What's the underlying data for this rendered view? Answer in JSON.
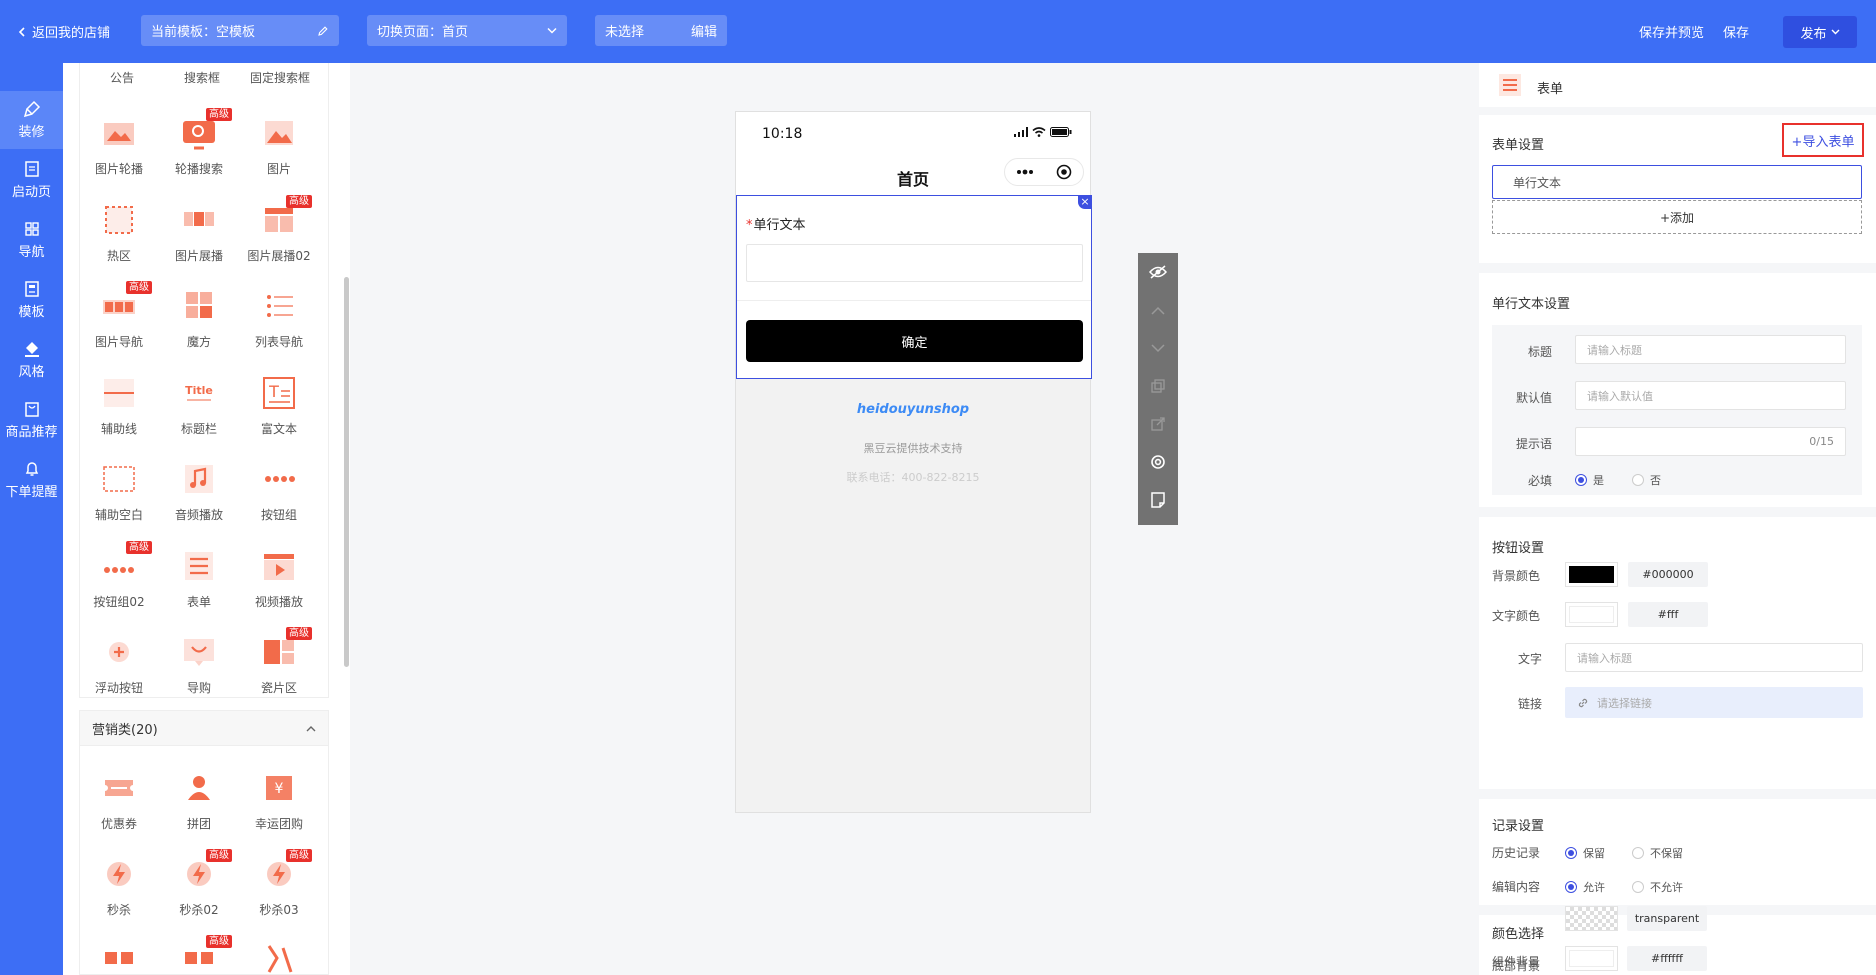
{
  "topbar": {
    "back_label": "返回我的店铺",
    "template_label": "当前模板：空模板",
    "switch_label": "切换页面：首页",
    "selected_label": "未选择",
    "edit_label": "编辑",
    "save_preview_label": "保存并预览",
    "save_label": "保存",
    "publish_label": "发布"
  },
  "rail": [
    {
      "label": "装修",
      "icon": "brush-icon",
      "active": true
    },
    {
      "label": "启动页",
      "icon": "page-icon"
    },
    {
      "label": "导航",
      "icon": "grid-icon"
    },
    {
      "label": "模板",
      "icon": "template-icon"
    },
    {
      "label": "风格",
      "icon": "paint-bucket-icon"
    },
    {
      "label": "商品推荐",
      "icon": "goods-icon"
    },
    {
      "label": "下单提醒",
      "icon": "bell-icon"
    }
  ],
  "components": {
    "top_row": [
      "公告",
      "搜索框",
      "固定搜索框"
    ],
    "basic": [
      {
        "label": "图片轮播",
        "icon": "image-carousel-icon"
      },
      {
        "label": "轮播搜索",
        "icon": "carousel-search-icon",
        "tag": "高级"
      },
      {
        "label": "图片",
        "icon": "image-icon"
      },
      {
        "label": "热区",
        "icon": "hotspot-icon"
      },
      {
        "label": "图片展播",
        "icon": "image-show-icon"
      },
      {
        "label": "图片展播02",
        "icon": "image-show2-icon",
        "tag": "高级"
      },
      {
        "label": "图片导航",
        "icon": "image-nav-icon",
        "tag": "高级"
      },
      {
        "label": "魔方",
        "icon": "cube-icon"
      },
      {
        "label": "列表导航",
        "icon": "list-nav-icon"
      },
      {
        "label": "辅助线",
        "icon": "divider-icon"
      },
      {
        "label": "标题栏",
        "icon": "title-icon"
      },
      {
        "label": "富文本",
        "icon": "richtext-icon"
      },
      {
        "label": "辅助空白",
        "icon": "blank-icon"
      },
      {
        "label": "音频播放",
        "icon": "audio-icon"
      },
      {
        "label": "按钮组",
        "icon": "button-group-icon"
      },
      {
        "label": "按钮组02",
        "icon": "button-group2-icon",
        "tag": "高级"
      },
      {
        "label": "表单",
        "icon": "form-icon"
      },
      {
        "label": "视频播放",
        "icon": "video-icon"
      },
      {
        "label": "浮动按钮",
        "icon": "float-button-icon"
      },
      {
        "label": "导购",
        "icon": "guide-icon"
      },
      {
        "label": "瓷片区",
        "icon": "tile-icon",
        "tag": "高级"
      }
    ],
    "marketing_group": "营销类(20)",
    "marketing": [
      {
        "label": "优惠券",
        "icon": "coupon-icon"
      },
      {
        "label": "拼团",
        "icon": "group-buy-icon"
      },
      {
        "label": "幸运团购",
        "icon": "lucky-icon"
      },
      {
        "label": "秒杀",
        "icon": "flash-icon"
      },
      {
        "label": "秒杀02",
        "icon": "flash2-icon",
        "tag": "高级"
      },
      {
        "label": "秒杀03",
        "icon": "flash3-icon",
        "tag": "高级"
      },
      {
        "label": "",
        "icon": "countdown-icon"
      },
      {
        "label": "",
        "icon": "countdown2-icon",
        "tag": "高级"
      },
      {
        "label": "",
        "icon": "bargain-icon"
      }
    ]
  },
  "phone": {
    "time": "10:18",
    "title": "首页",
    "field_label": "单行文本",
    "required_mark": "*",
    "submit_label": "确定",
    "brand": "heidouyunshop",
    "support": "黑豆云提供技术支持",
    "contact": "联系电话：400-822-8215",
    "close_mark": "×"
  },
  "right": {
    "header_title": "表单",
    "form_settings": "表单设置",
    "import_label": "+导入表单",
    "field_item": "单行文本",
    "add_label": "+添加",
    "text_settings": "单行文本设置",
    "title_label": "标题",
    "title_placeholder": "请输入标题",
    "default_label": "默认值",
    "default_placeholder": "请输入默认值",
    "hint_label": "提示语",
    "hint_count": "0/15",
    "required_label": "必填",
    "yes": "是",
    "no": "否",
    "button_settings": "按钮设置",
    "bg_color_label": "背景颜色",
    "bg_color": "#000000",
    "text_color_label": "文字颜色",
    "text_color": "#fff",
    "text_label": "文字",
    "text_placeholder": "请输入标题",
    "link_label": "链接",
    "link_placeholder": "请选择链接",
    "record_settings": "记录设置",
    "history_label": "历史记录",
    "keep": "保留",
    "not_keep": "不保留",
    "edit_content_label": "编辑内容",
    "allow": "允许",
    "not_allow": "不允许",
    "color_select": "颜色选择",
    "bottom_bg_label": "底部背景",
    "bottom_bg": "transparent",
    "comp_bg_label": "组件背景",
    "comp_bg": "#ffffff"
  },
  "colors": {
    "brand": "#3d6ef5",
    "accent": "#3d4fe0",
    "icon": "#f26b4a",
    "tag": "#e8312c"
  }
}
